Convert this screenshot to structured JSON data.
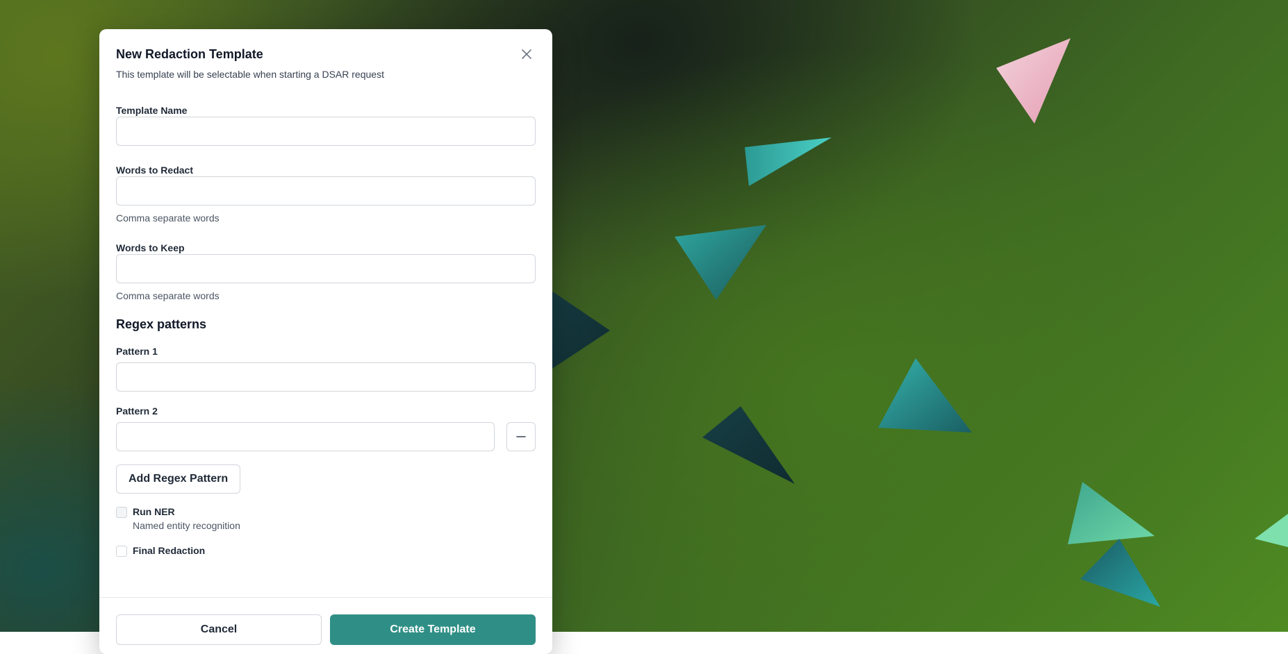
{
  "modal": {
    "title": "New Redaction Template",
    "subtitle": "This template will be selectable when starting a DSAR request",
    "close_icon": "close-icon"
  },
  "fields": {
    "template_name": {
      "label": "Template Name",
      "value": "",
      "placeholder": ""
    },
    "words_to_redact": {
      "label": "Words to Redact",
      "value": "",
      "placeholder": "",
      "hint": "Comma separate words"
    },
    "words_to_keep": {
      "label": "Words to Keep",
      "value": "",
      "placeholder": "",
      "hint": "Comma separate words"
    }
  },
  "regex": {
    "section_title": "Regex patterns",
    "patterns": [
      {
        "label": "Pattern 1",
        "value": ""
      },
      {
        "label": "Pattern 2",
        "value": "",
        "remove_icon": "minus-icon"
      }
    ],
    "add_button": "Add Regex Pattern"
  },
  "options": {
    "run_ner": {
      "label": "Run NER",
      "description": "Named entity recognition",
      "checked": false,
      "disabled": true
    },
    "final_redaction": {
      "label": "Final Redaction",
      "checked": false
    }
  },
  "footer": {
    "cancel_label": "Cancel",
    "create_label": "Create Template"
  },
  "colors": {
    "primary": "#2f8f86",
    "background_green": "#3e6a22"
  }
}
